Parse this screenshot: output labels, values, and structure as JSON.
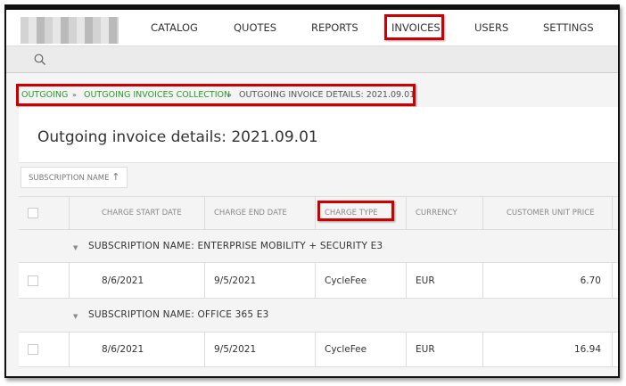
{
  "nav": {
    "items": [
      "CATALOG",
      "QUOTES",
      "REPORTS",
      "INVOICES",
      "USERS",
      "SETTINGS"
    ],
    "active": "INVOICES"
  },
  "search": {
    "icon": "search-icon"
  },
  "breadcrumb": {
    "items": [
      "OUTGOING",
      "OUTGOING INVOICES COLLECTION",
      "OUTGOING INVOICE DETAILS: 2021.09.01"
    ],
    "separator": "»"
  },
  "page_title": "Outgoing invoice details: 2021.09.01",
  "grouping": {
    "chip": "SUBSCRIPTION NAME",
    "sort_icon": "arrow-up-icon"
  },
  "table": {
    "columns": [
      "CHARGE START DATE",
      "CHARGE END DATE",
      "CHARGE TYPE",
      "CURRENCY",
      "CUSTOMER UNIT PRICE"
    ],
    "groups": [
      {
        "label": "SUBSCRIPTION NAME: ENTERPRISE MOBILITY + SECURITY E3",
        "rows": [
          [
            "8/6/2021",
            "9/5/2021",
            "CycleFee",
            "EUR",
            "6.70"
          ]
        ]
      },
      {
        "label": "SUBSCRIPTION NAME: OFFICE 365 E3",
        "rows": [
          [
            "8/6/2021",
            "9/5/2021",
            "CycleFee",
            "EUR",
            "16.94"
          ]
        ]
      }
    ]
  },
  "colors": {
    "highlight": "#cc0000",
    "link": "#2a9a2a"
  }
}
